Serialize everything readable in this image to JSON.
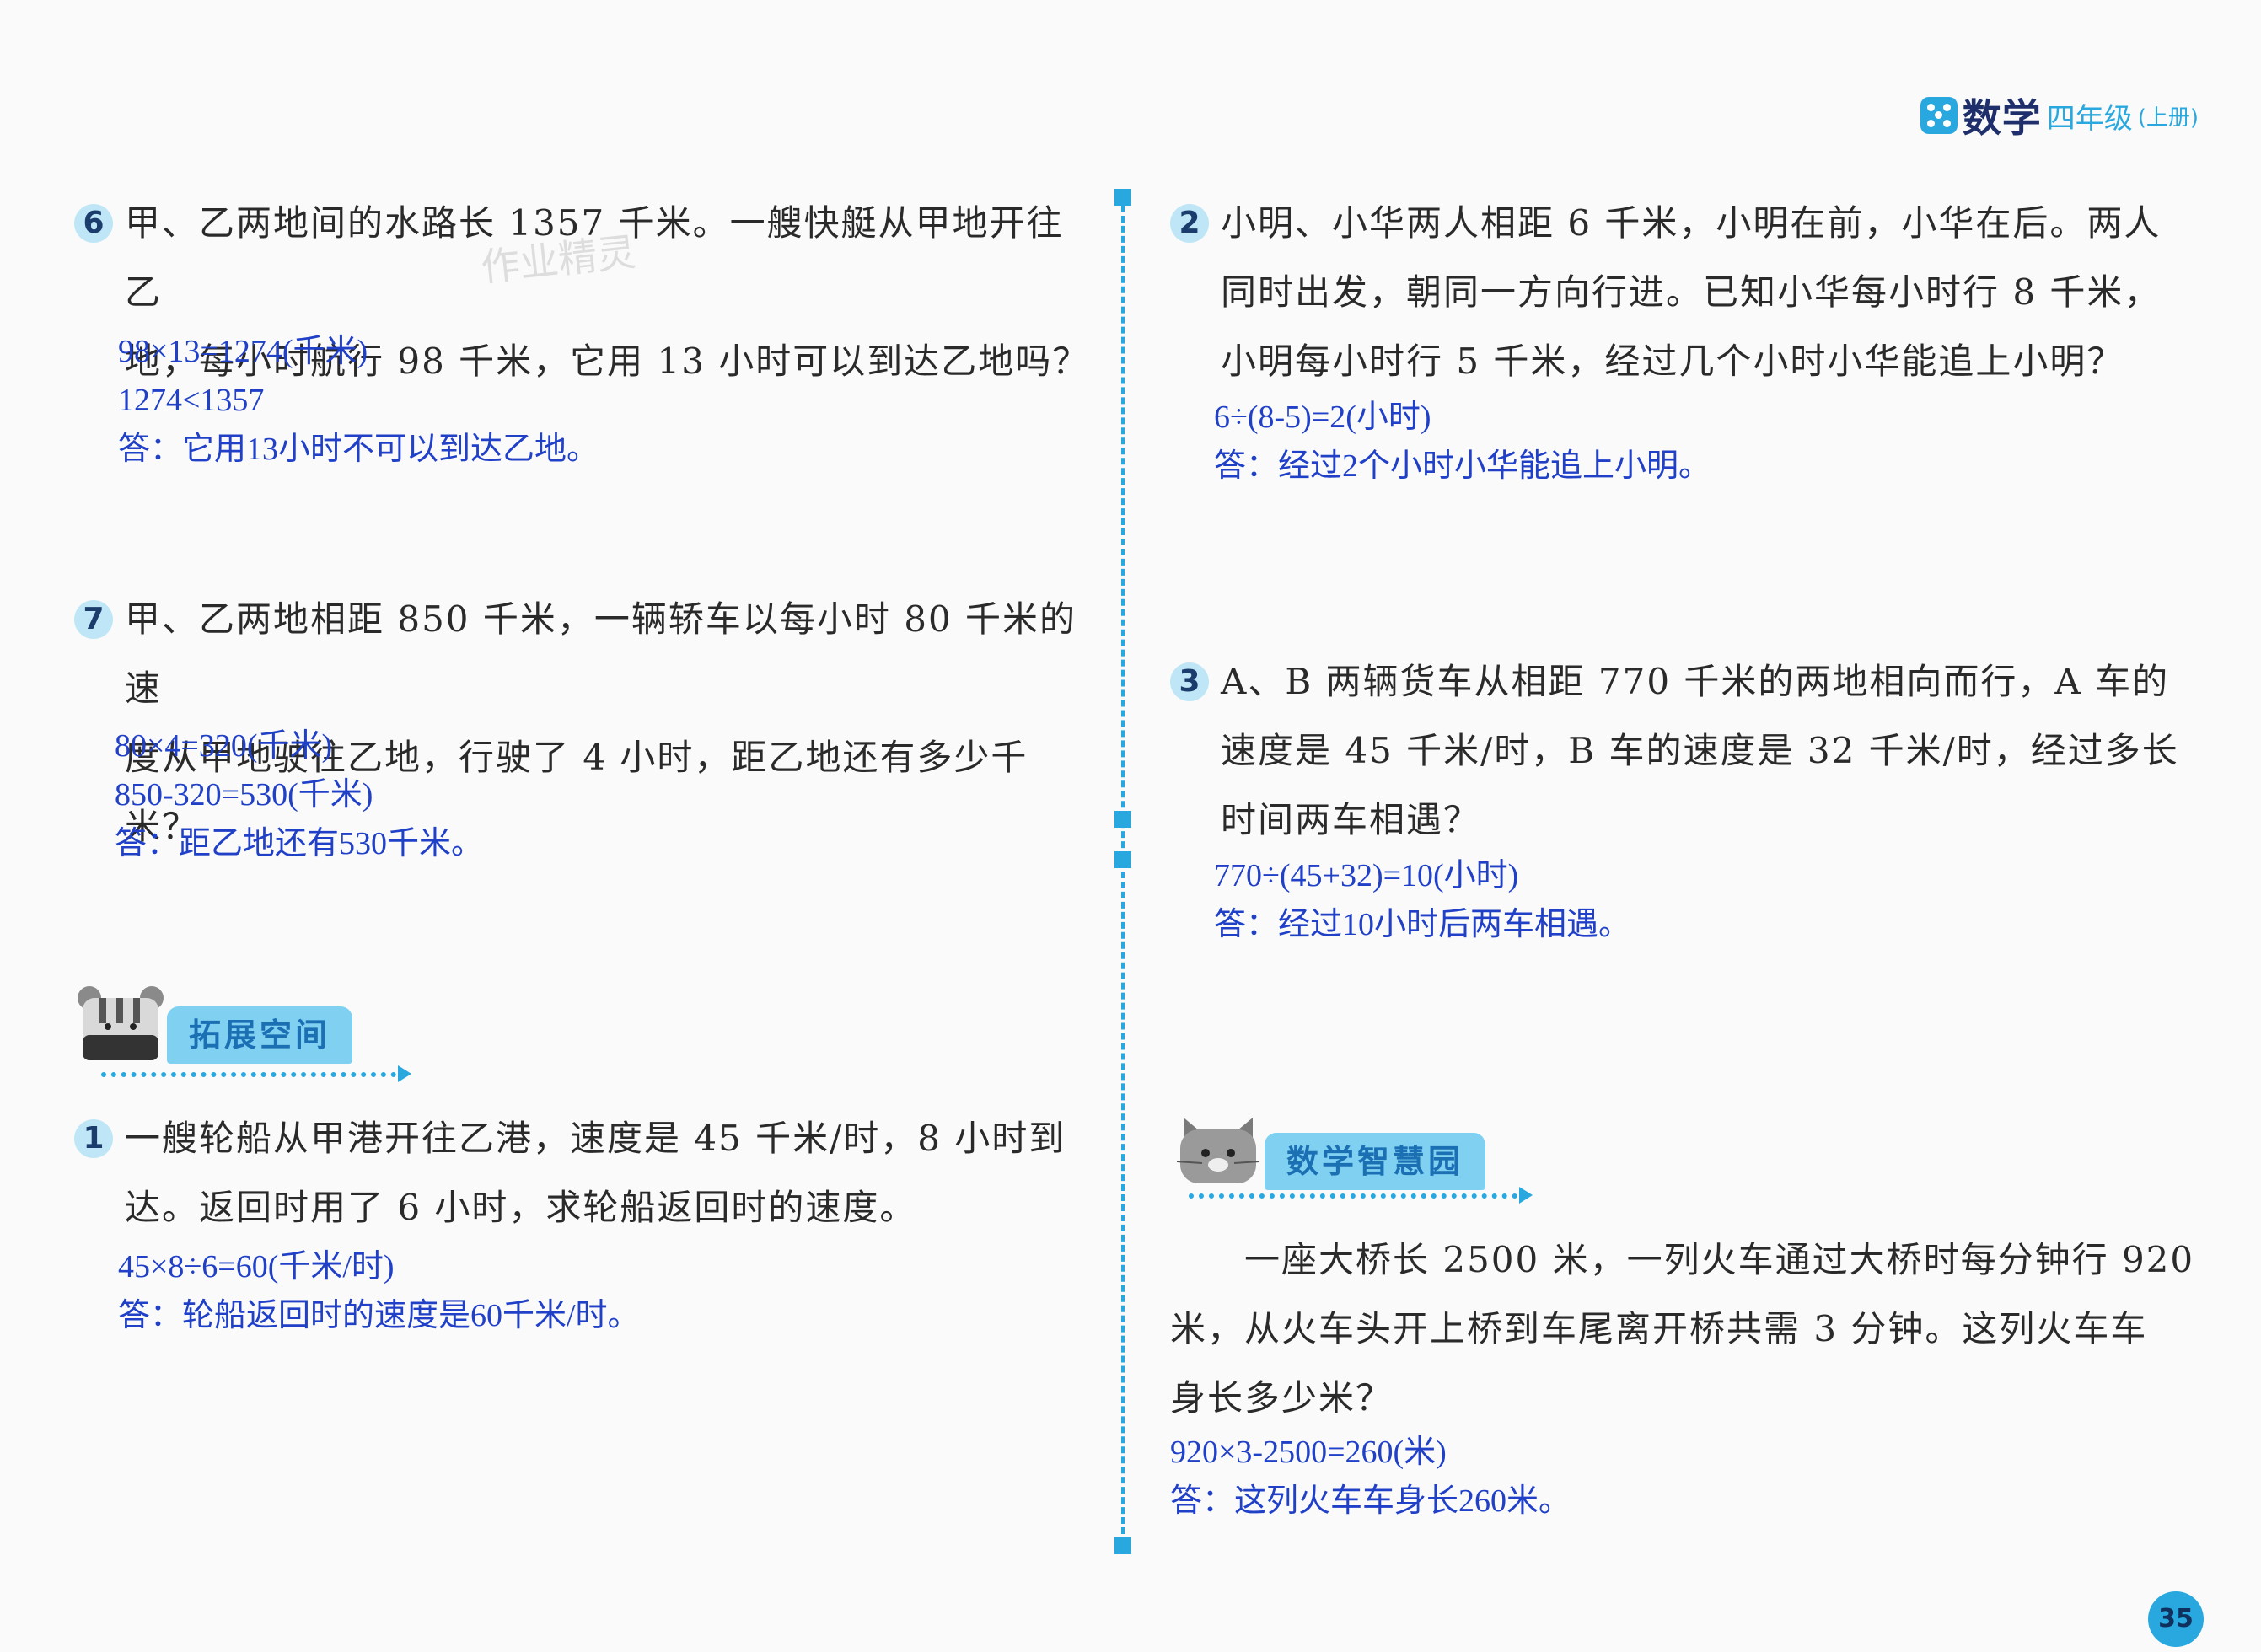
{
  "header": {
    "subject": "数学",
    "grade": "四年级",
    "volume": "(上册)"
  },
  "watermark": "作业精灵",
  "left": {
    "q6": {
      "number": "6",
      "lines": [
        "甲、乙两地间的水路长 1357 千米。一艘快艇从甲地开往乙",
        "地，每小时航行 98 千米，它用 13 小时可以到达乙地吗？"
      ],
      "answer": [
        "98×13=1274(千米)",
        "1274<1357",
        "答：它用13小时不可以到达乙地。"
      ]
    },
    "q7": {
      "number": "7",
      "lines": [
        "甲、乙两地相距 850 千米，一辆轿车以每小时 80 千米的速",
        "度从甲地驶往乙地，行驶了 4 小时，距乙地还有多少千米？"
      ],
      "answer": [
        "80×4=320(千米)",
        "850-320=530(千米)",
        "答：距乙地还有530千米。"
      ]
    },
    "section": {
      "title": "拓展空间"
    },
    "e1": {
      "number": "1",
      "lines": [
        "一艘轮船从甲港开往乙港，速度是 45 千米/时，8 小时到",
        "达。返回时用了 6 小时，求轮船返回时的速度。"
      ],
      "answer": [
        "45×8÷6=60(千米/时)",
        "答：轮船返回时的速度是60千米/时。"
      ]
    }
  },
  "right": {
    "q2": {
      "number": "2",
      "lines": [
        "小明、小华两人相距 6 千米，小明在前，小华在后。两人",
        "同时出发，朝同一方向行进。已知小华每小时行 8 千米，",
        "小明每小时行 5 千米，经过几个小时小华能追上小明？"
      ],
      "answer": [
        "6÷(8-5)=2(小时)",
        "答：经过2个小时小华能追上小明。"
      ]
    },
    "q3": {
      "number": "3",
      "lines": [
        "A、B 两辆货车从相距 770 千米的两地相向而行，A 车的",
        "速度是 45 千米/时，B 车的速度是 32 千米/时，经过多长",
        "时间两车相遇？"
      ],
      "answer": [
        "770÷(45+32)=10(小时)",
        "答：经过10小时后两车相遇。"
      ]
    },
    "section": {
      "title": "数学智慧园"
    },
    "wisdom": {
      "lines": [
        "　　一座大桥长 2500 米，一列火车通过大桥时每分钟行 920",
        "米，从火车头开上桥到车尾离开桥共需 3 分钟。这列火车车",
        "身长多少米？"
      ],
      "answer": [
        "920×3-2500=260(米)",
        "答：这列火车车身长260米。"
      ]
    }
  },
  "page_number": "35",
  "colors": {
    "accent": "#29a8e0",
    "answer": "#2140c8",
    "tag_bg": "#7fd0f1"
  }
}
